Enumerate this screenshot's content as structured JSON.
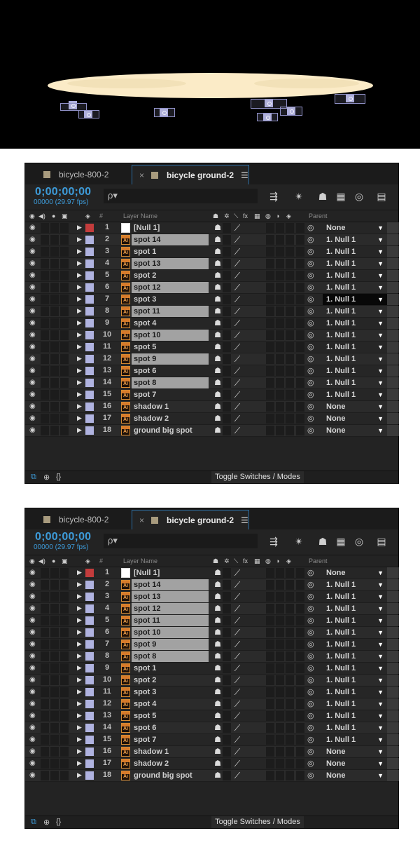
{
  "panels": [
    {
      "tabs": {
        "inactive": "bicycle-800-2",
        "active": "bicycle ground-2",
        "close": "×",
        "menu": "☰"
      },
      "timecode": "0;00;00;00",
      "frame_fps": "00000 (29.97 fps)",
      "search_placeholder": "ρ▾",
      "headers": {
        "name": "Layer Name",
        "parent": "Parent",
        "label": "#"
      },
      "footer_toggle": "Toggle Switches / Modes",
      "layers": [
        {
          "num": "1",
          "name": "[Null 1]",
          "type": "null",
          "highlight": false,
          "parent": "None"
        },
        {
          "num": "2",
          "name": "spot 14",
          "type": "ai",
          "highlight": true,
          "parent": "1. Null 1"
        },
        {
          "num": "3",
          "name": "spot 1",
          "type": "ai",
          "highlight": false,
          "parent": "1. Null 1"
        },
        {
          "num": "4",
          "name": "spot 13",
          "type": "ai",
          "highlight": true,
          "parent": "1. Null 1"
        },
        {
          "num": "5",
          "name": "spot 2",
          "type": "ai",
          "highlight": false,
          "parent": "1. Null 1"
        },
        {
          "num": "6",
          "name": "spot 12",
          "type": "ai",
          "highlight": true,
          "parent": "1. Null 1"
        },
        {
          "num": "7",
          "name": "spot 3",
          "type": "ai",
          "highlight": false,
          "parent": "1. Null 1",
          "parent_active": true
        },
        {
          "num": "8",
          "name": "spot 11",
          "type": "ai",
          "highlight": true,
          "parent": "1. Null 1"
        },
        {
          "num": "9",
          "name": "spot 4",
          "type": "ai",
          "highlight": false,
          "parent": "1. Null 1"
        },
        {
          "num": "10",
          "name": "spot 10",
          "type": "ai",
          "highlight": true,
          "parent": "1. Null 1"
        },
        {
          "num": "11",
          "name": "spot 5",
          "type": "ai",
          "highlight": false,
          "parent": "1. Null 1"
        },
        {
          "num": "12",
          "name": "spot 9",
          "type": "ai",
          "highlight": true,
          "parent": "1. Null 1"
        },
        {
          "num": "13",
          "name": "spot 6",
          "type": "ai",
          "highlight": false,
          "parent": "1. Null 1"
        },
        {
          "num": "14",
          "name": "spot 8",
          "type": "ai",
          "highlight": true,
          "parent": "1. Null 1"
        },
        {
          "num": "15",
          "name": "spot 7",
          "type": "ai",
          "highlight": false,
          "parent": "1. Null 1"
        },
        {
          "num": "16",
          "name": "shadow 1",
          "type": "ai",
          "highlight": false,
          "parent": "None"
        },
        {
          "num": "17",
          "name": "shadow 2",
          "type": "ai",
          "highlight": false,
          "parent": "None"
        },
        {
          "num": "18",
          "name": "ground big spot",
          "type": "ai",
          "highlight": false,
          "parent": "None"
        }
      ]
    },
    {
      "tabs": {
        "inactive": "bicycle-800-2",
        "active": "bicycle ground-2",
        "close": "×",
        "menu": "☰"
      },
      "timecode": "0;00;00;00",
      "frame_fps": "00000 (29.97 fps)",
      "search_placeholder": "ρ▾",
      "headers": {
        "name": "Layer Name",
        "parent": "Parent",
        "label": "#"
      },
      "footer_toggle": "Toggle Switches / Modes",
      "layers": [
        {
          "num": "1",
          "name": "[Null 1]",
          "type": "null",
          "highlight": false,
          "parent": "None"
        },
        {
          "num": "2",
          "name": "spot 14",
          "type": "ai",
          "highlight": true,
          "parent": "1. Null 1"
        },
        {
          "num": "3",
          "name": "spot 13",
          "type": "ai",
          "highlight": true,
          "parent": "1. Null 1"
        },
        {
          "num": "4",
          "name": "spot 12",
          "type": "ai",
          "highlight": true,
          "parent": "1. Null 1"
        },
        {
          "num": "5",
          "name": "spot 11",
          "type": "ai",
          "highlight": true,
          "parent": "1. Null 1"
        },
        {
          "num": "6",
          "name": "spot 10",
          "type": "ai",
          "highlight": true,
          "parent": "1. Null 1"
        },
        {
          "num": "7",
          "name": "spot 9",
          "type": "ai",
          "highlight": true,
          "parent": "1. Null 1"
        },
        {
          "num": "8",
          "name": "spot 8",
          "type": "ai",
          "highlight": true,
          "parent": "1. Null 1"
        },
        {
          "num": "9",
          "name": "spot 1",
          "type": "ai",
          "highlight": false,
          "parent": "1. Null 1"
        },
        {
          "num": "10",
          "name": "spot 2",
          "type": "ai",
          "highlight": false,
          "parent": "1. Null 1"
        },
        {
          "num": "11",
          "name": "spot 3",
          "type": "ai",
          "highlight": false,
          "parent": "1. Null 1"
        },
        {
          "num": "12",
          "name": "spot 4",
          "type": "ai",
          "highlight": false,
          "parent": "1. Null 1"
        },
        {
          "num": "13",
          "name": "spot 5",
          "type": "ai",
          "highlight": false,
          "parent": "1. Null 1"
        },
        {
          "num": "14",
          "name": "spot 6",
          "type": "ai",
          "highlight": false,
          "parent": "1. Null 1"
        },
        {
          "num": "15",
          "name": "spot 7",
          "type": "ai",
          "highlight": false,
          "parent": "1. Null 1"
        },
        {
          "num": "16",
          "name": "shadow 1",
          "type": "ai",
          "highlight": false,
          "parent": "None"
        },
        {
          "num": "17",
          "name": "shadow 2",
          "type": "ai",
          "highlight": false,
          "parent": "None"
        },
        {
          "num": "18",
          "name": "ground big spot",
          "type": "ai",
          "highlight": false,
          "parent": "None"
        }
      ]
    }
  ],
  "colors": {
    "accent": "#3d9bd9",
    "label_lavender": "#b0b3e0",
    "label_red": "#c33c3c",
    "ground_ellipse": "#fbebc7"
  },
  "icons": [
    "eye-icon",
    "audio-icon",
    "solo-icon",
    "lock-icon",
    "label-tag-icon",
    "shy-icon",
    "collapse-icon",
    "quality-icon",
    "fx-icon",
    "frame-blend-icon",
    "motion-blur-icon",
    "adjustment-icon",
    "3d-layer-icon",
    "pickwhip-icon",
    "search-icon",
    "flowchart-icon",
    "draft3d-icon",
    "shy-toggle-icon",
    "frame-blend-toggle-icon",
    "motion-blur-toggle-icon",
    "graph-editor-icon"
  ]
}
